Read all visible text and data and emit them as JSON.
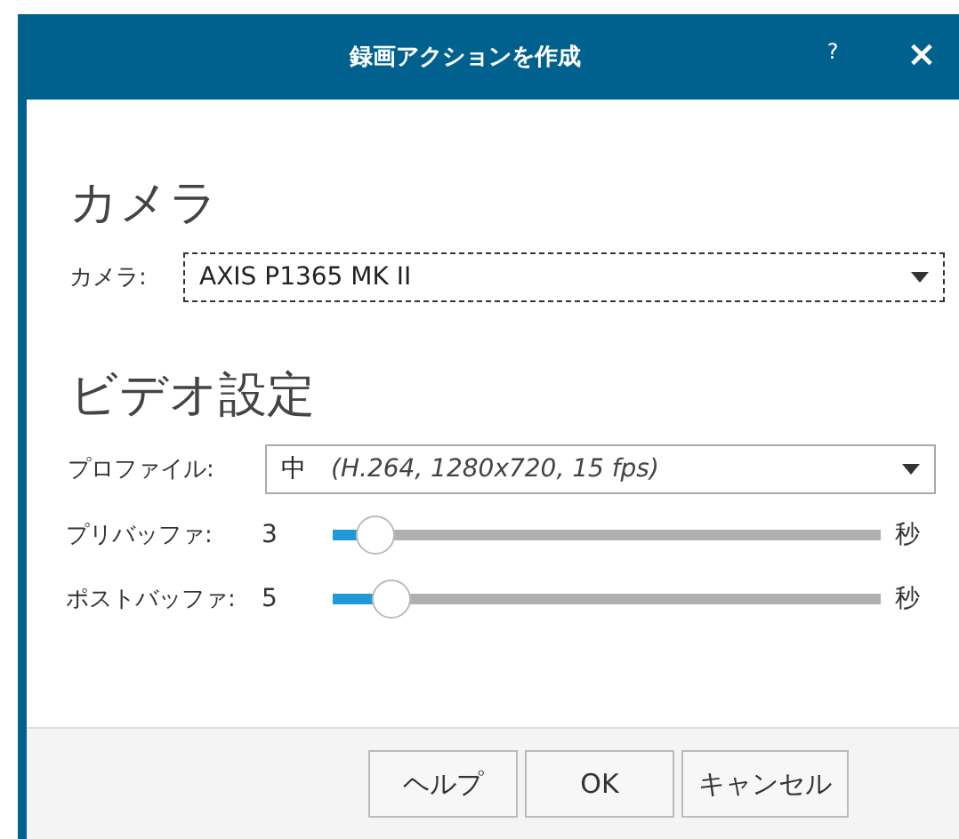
{
  "window": {
    "title": "録画アクションを作成",
    "help": "?",
    "close": "×"
  },
  "sections": [
    {
      "heading": "カメラ",
      "rows": [
        {
          "kind": "select",
          "label": "カメラ:",
          "value": "AXIS P1365 MK II",
          "focused": true
        }
      ]
    },
    {
      "heading": "ビデオ設定",
      "rows": [
        {
          "kind": "select",
          "label": "プロファイル:",
          "value": "中",
          "detail": "(H.264, 1280x720, 15 fps)",
          "focused": false
        },
        {
          "kind": "slider",
          "label": "プリバッファ:",
          "reading": "3",
          "level": 0.08,
          "unit": "秒"
        },
        {
          "kind": "slider",
          "label": "ポストバッファ:",
          "reading": "5",
          "level": 0.11,
          "unit": "秒"
        }
      ]
    }
  ],
  "buttons": [
    "ヘルプ",
    "OK",
    "キャンセル"
  ]
}
